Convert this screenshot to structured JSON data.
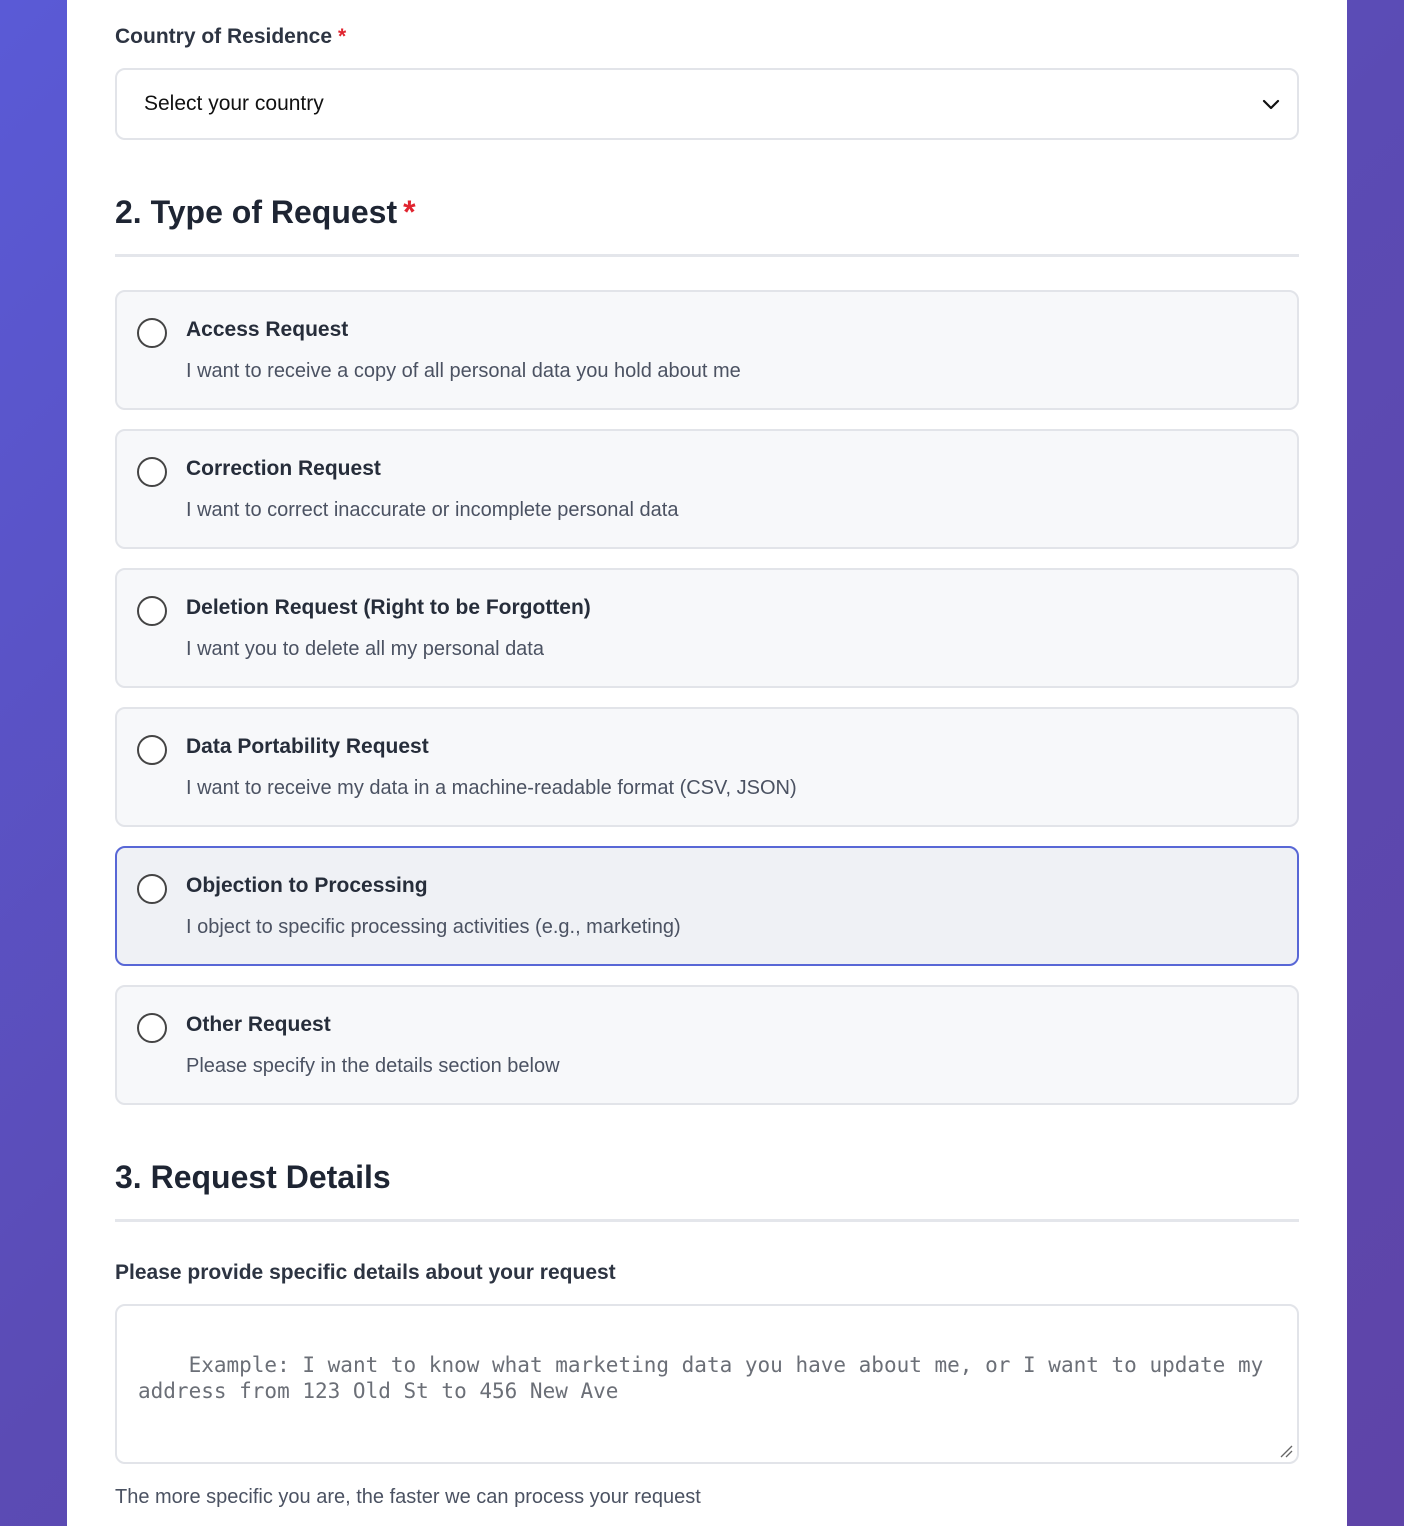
{
  "country": {
    "label": "Country of Residence",
    "required_mark": "*",
    "selected": "Select your country"
  },
  "section2": {
    "title": "2. Type of Request",
    "required_mark": "*",
    "options": [
      {
        "title": "Access Request",
        "desc": "I want to receive a copy of all personal data you hold about me"
      },
      {
        "title": "Correction Request",
        "desc": "I want to correct inaccurate or incomplete personal data"
      },
      {
        "title": "Deletion Request (Right to be Forgotten)",
        "desc": "I want you to delete all my personal data"
      },
      {
        "title": "Data Portability Request",
        "desc": "I want to receive my data in a machine-readable format (CSV, JSON)"
      },
      {
        "title": "Objection to Processing",
        "desc": "I object to specific processing activities (e.g., marketing)"
      },
      {
        "title": "Other Request",
        "desc": "Please specify in the details section below"
      }
    ]
  },
  "section3": {
    "title": "3. Request Details",
    "details_label": "Please provide specific details about your request",
    "placeholder": "Example: I want to know what marketing data you have about me, or I want to update my address from 123 Old St to 456 New Ave",
    "help_text": "The more specific you are, the faster we can process your request"
  },
  "colors": {
    "required": "#e0242f",
    "accent": "#5867d6"
  }
}
